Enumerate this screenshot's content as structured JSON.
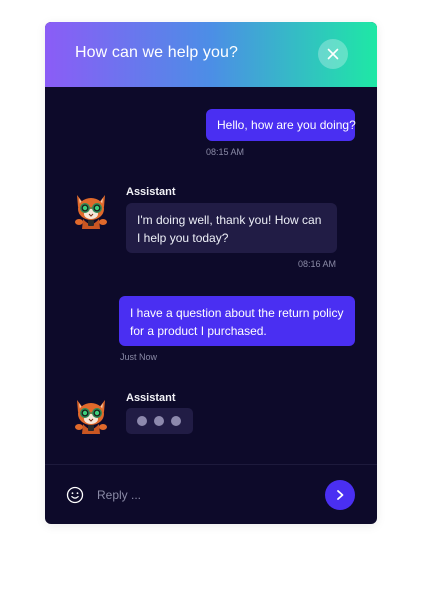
{
  "header": {
    "title": "How can we help you?",
    "close_icon": "close-icon"
  },
  "messages": [
    {
      "sender": "user",
      "text": "Hello, how are you doing?",
      "time": "08:15 AM"
    },
    {
      "sender": "Assistant",
      "text": "I'm doing well, thank you! How can I help you today?",
      "time": "08:16 AM"
    },
    {
      "sender": "user",
      "text": "I have a question about the return policy for a product I purchased.",
      "time": "Just Now"
    },
    {
      "sender": "Assistant",
      "typing": true
    }
  ],
  "composer": {
    "placeholder": "Reply ...",
    "emoji_icon": "smiley-icon",
    "send_icon": "chevron-right-icon"
  },
  "colors": {
    "panel_bg": "#0d0a2a",
    "user_bubble": "#4a2ff2",
    "assistant_bubble": "#211c45",
    "header_gradient_start": "#8b5cf6",
    "header_gradient_end": "#1ee8a5",
    "send_button": "#4a2ff2"
  }
}
